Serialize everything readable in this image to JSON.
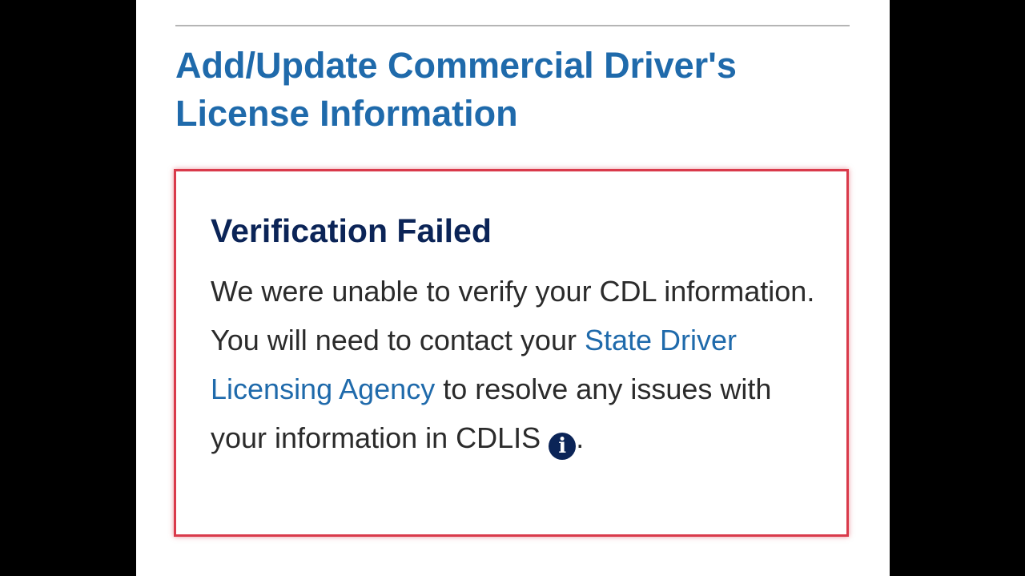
{
  "header": {
    "title": "Add/Update Commercial Driver's License Information"
  },
  "alert": {
    "heading": "Verification Failed",
    "text_before_link": "We were unable to verify your CDL information. You will need to contact your ",
    "link_text": "State Driver Licensing Agency",
    "text_after_link": " to resolve any issues with your information in CDLIS ",
    "info_icon_glyph": "i",
    "info_icon": "info-circle-icon",
    "trailing_text": "."
  },
  "colors": {
    "background": "#000000",
    "panel": "#ffffff",
    "title": "#1f6aab",
    "alert_border": "#d93a4b",
    "alert_heading": "#0b2457",
    "body_text": "#2b2b2b",
    "link": "#1f6aab"
  }
}
